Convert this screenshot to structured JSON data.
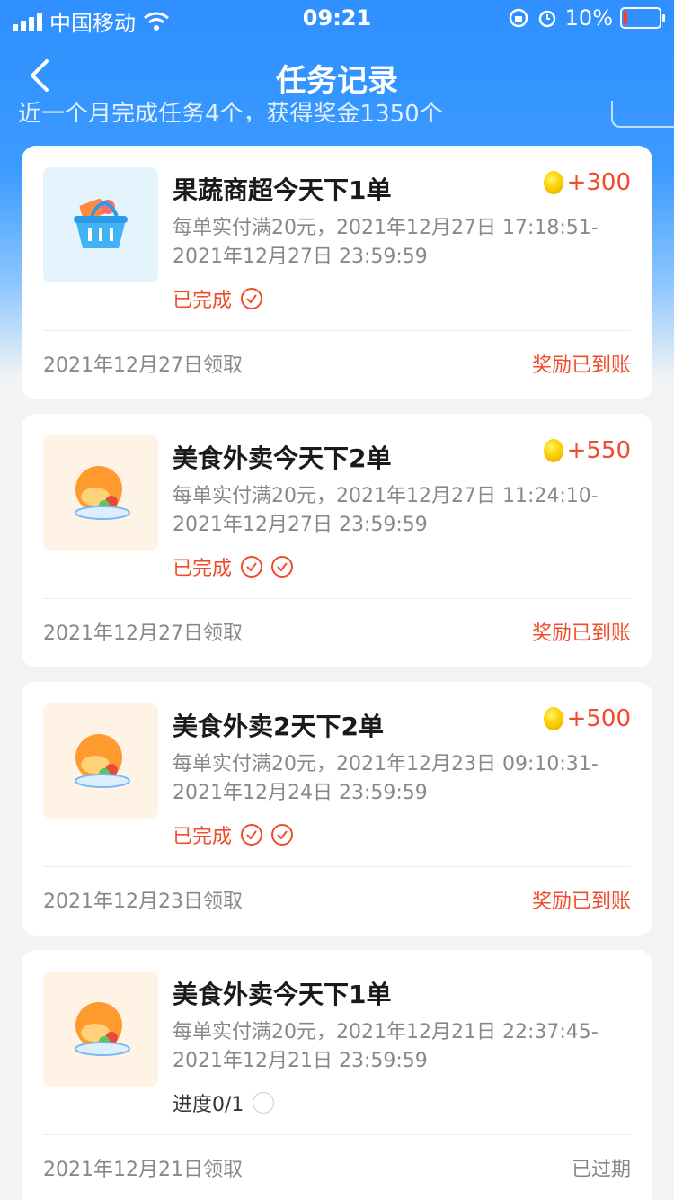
{
  "status_bar": {
    "carrier": "中国移动",
    "time": "09:21",
    "battery": "10%",
    "battery_level": 0.1
  },
  "nav": {
    "title": "任务记录"
  },
  "peek": {
    "text": "近一个月完成任务4个，获得奖金1350个"
  },
  "colors": {
    "accent": "#f04b2b",
    "brand": "#2f8fff"
  },
  "tasks": [
    {
      "title": "果蔬商超今天下1单",
      "reward": "+300",
      "desc": "每单实付满20元，2021年12月27日 17:18:51-2021年12月27日 23:59:59",
      "status": "已完成",
      "received": "2021年12月27日领取",
      "result": "奖励已到账",
      "icon": "basket"
    },
    {
      "title": "美食外卖今天下2单",
      "reward": "+550",
      "desc": "每单实付满20元，2021年12月27日 11:24:10-2021年12月27日 23:59:59",
      "status": "已完成",
      "received": "2021年12月27日领取",
      "result": "奖励已到账",
      "icon": "food"
    },
    {
      "title": "美食外卖2天下2单",
      "reward": "+500",
      "desc": "每单实付满20元，2021年12月23日 09:10:31-2021年12月24日 23:59:59",
      "status": "已完成",
      "received": "2021年12月23日领取",
      "result": "奖励已到账",
      "icon": "food"
    },
    {
      "title": "美食外卖今天下1单",
      "reward": "",
      "desc": "每单实付满20元，2021年12月21日 22:37:45-2021年12月21日 23:59:59",
      "status": "进度0/1",
      "received": "2021年12月21日领取",
      "result": "已过期",
      "icon": "food"
    }
  ]
}
